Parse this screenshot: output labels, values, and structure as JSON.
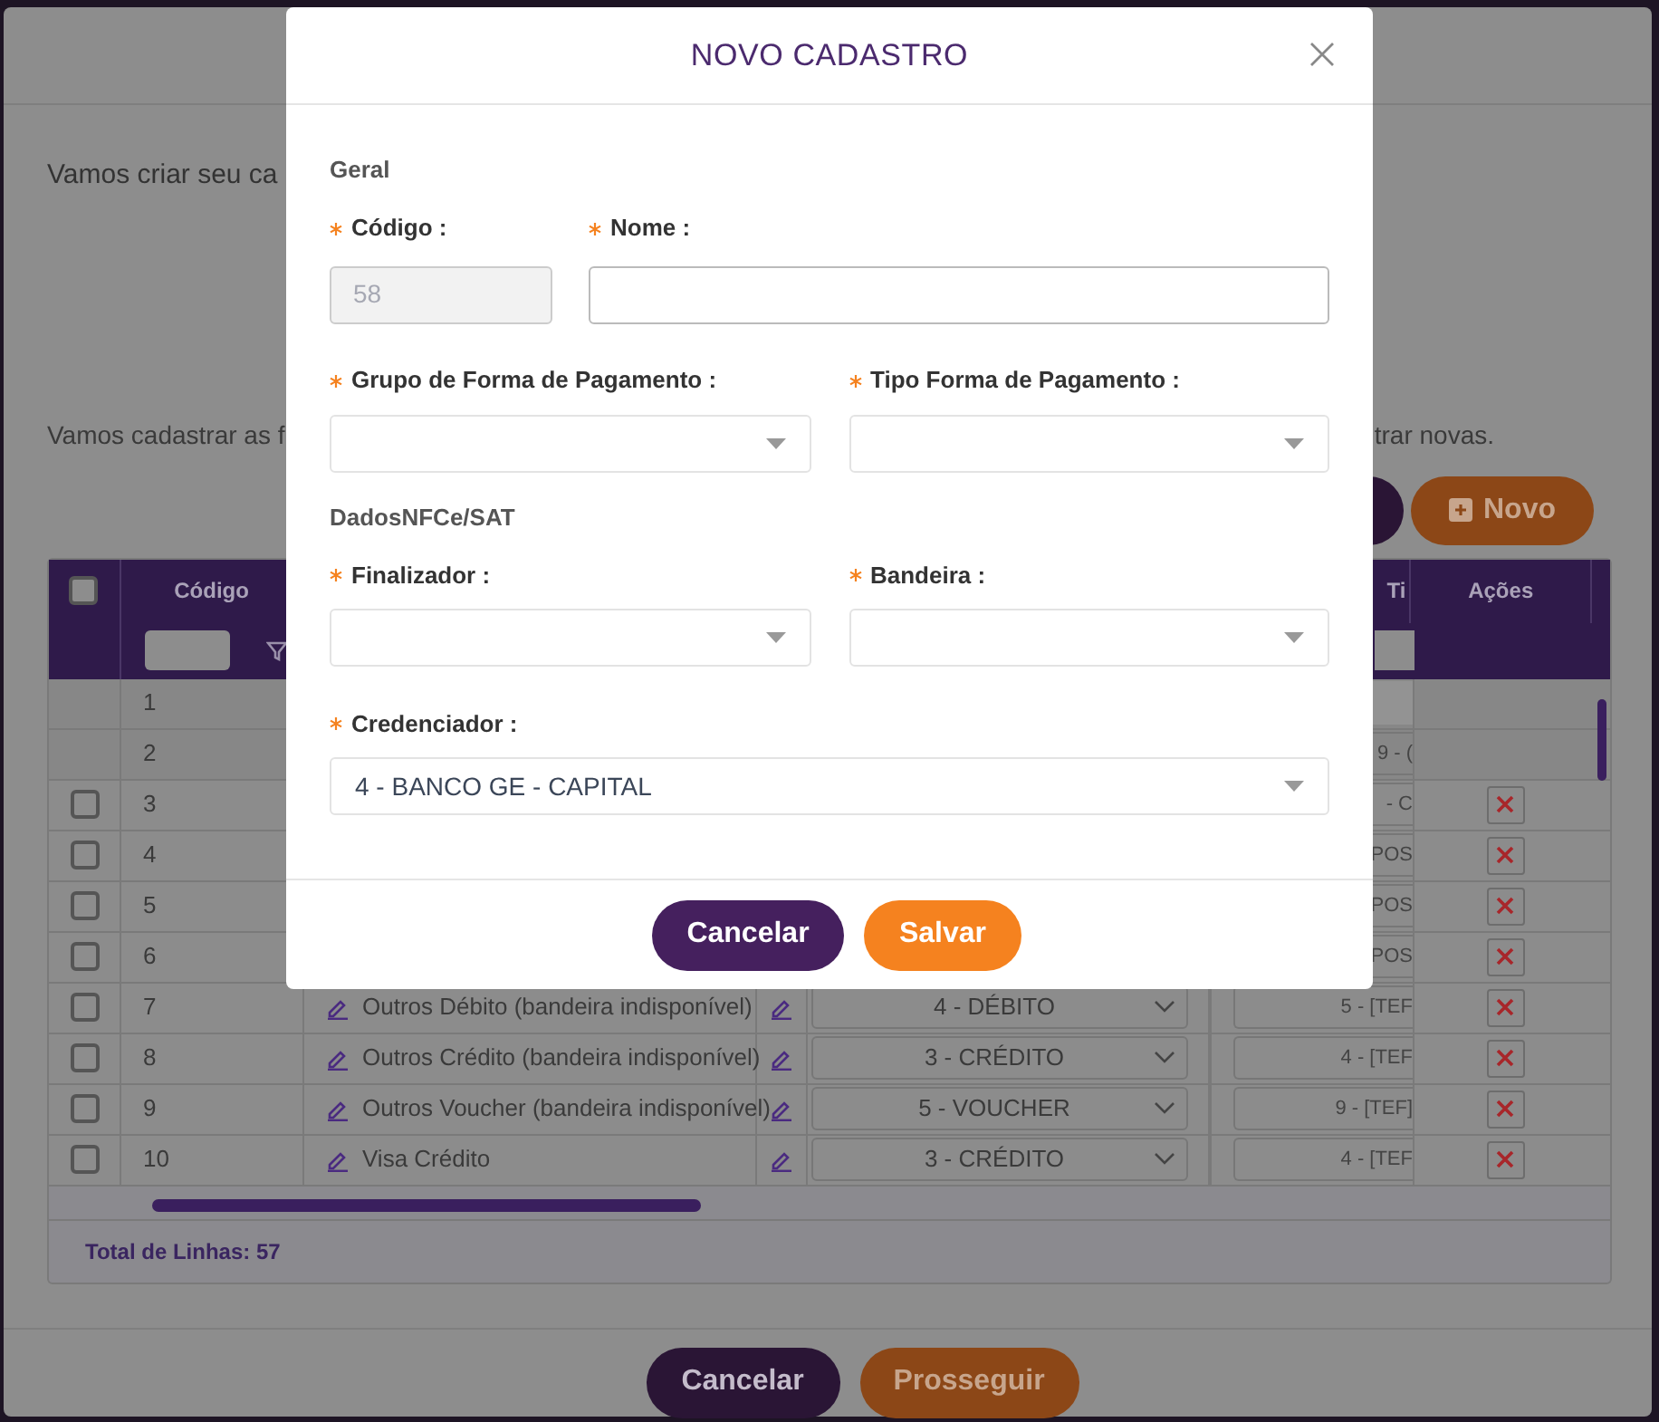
{
  "background": {
    "intro": "Vamos criar seu ca",
    "instruction_start": "Vamos cadastrar as f",
    "instruction_end": "trar novas.",
    "new_button": {
      "label": "Novo"
    },
    "table": {
      "select_all": {
        "checked": false
      },
      "columns": [
        {
          "label": "Código"
        },
        {
          "label": "Ti"
        },
        {
          "label": "Ações"
        }
      ],
      "rows": [
        {
          "kind": "default",
          "code": "1"
        },
        {
          "kind": "default",
          "code": "2",
          "method": "9 - ("
        },
        {
          "kind": "custom",
          "checked": false,
          "code": "3",
          "method": "- C"
        },
        {
          "kind": "custom",
          "checked": false,
          "code": "4",
          "method": "POS"
        },
        {
          "kind": "custom",
          "checked": false,
          "code": "5",
          "method": "POS"
        },
        {
          "kind": "custom",
          "checked": false,
          "code": "6",
          "method": "POS"
        },
        {
          "kind": "custom",
          "checked": false,
          "code": "7",
          "name": "Outros Débito (bandeira indisponível)",
          "type": "4 - DÉBITO",
          "method": "5 - [TEF"
        },
        {
          "kind": "custom",
          "checked": false,
          "code": "8",
          "name": "Outros Crédito (bandeira indisponível)",
          "type": "3 - CRÉDITO",
          "method": "4 - [TEF"
        },
        {
          "kind": "custom",
          "checked": false,
          "code": "9",
          "name": "Outros Voucher (bandeira indisponível)",
          "type": "5 - VOUCHER",
          "method": "9 - [TEF]"
        },
        {
          "kind": "custom",
          "checked": false,
          "code": "10",
          "name": "Visa Crédito",
          "type": "3 - CRÉDITO",
          "method": "4 - [TEF"
        }
      ],
      "total": "Total de Linhas: 57"
    },
    "buttons": [
      {
        "label": "Cancelar",
        "kind": "primary"
      },
      {
        "label": "Prosseguir",
        "kind": "accent"
      }
    ]
  },
  "modal": {
    "title": "NOVO CADASTRO",
    "sections": [
      {
        "title": "Geral",
        "rows": [
          {
            "kind": "narrow-wide",
            "fields": [
              {
                "label": "Código :",
                "kind": "input",
                "required": true,
                "disabled": true,
                "value": "58"
              },
              {
                "label": "Nome :",
                "kind": "input",
                "required": true,
                "disabled": false
              }
            ]
          },
          {
            "kind": "halves",
            "fields": [
              {
                "label": "Grupo de Forma de Pagamento :",
                "kind": "select",
                "required": true
              },
              {
                "label": "Tipo Forma de Pagamento :",
                "kind": "select",
                "required": true
              }
            ]
          }
        ]
      },
      {
        "title": "DadosNFCe/SAT",
        "rows": [
          {
            "kind": "halves",
            "fields": [
              {
                "label": "Finalizador :",
                "kind": "select",
                "required": true
              },
              {
                "label": "Bandeira :",
                "kind": "select",
                "required": true
              }
            ]
          },
          {
            "kind": "full",
            "fields": [
              {
                "label": "Credenciador :",
                "kind": "select",
                "required": true,
                "value": "4 - BANCO GE - CAPITAL"
              }
            ]
          }
        ]
      }
    ],
    "buttons": [
      {
        "label": "Cancelar",
        "kind": "primary"
      },
      {
        "label": "Salvar",
        "kind": "accent"
      }
    ]
  }
}
